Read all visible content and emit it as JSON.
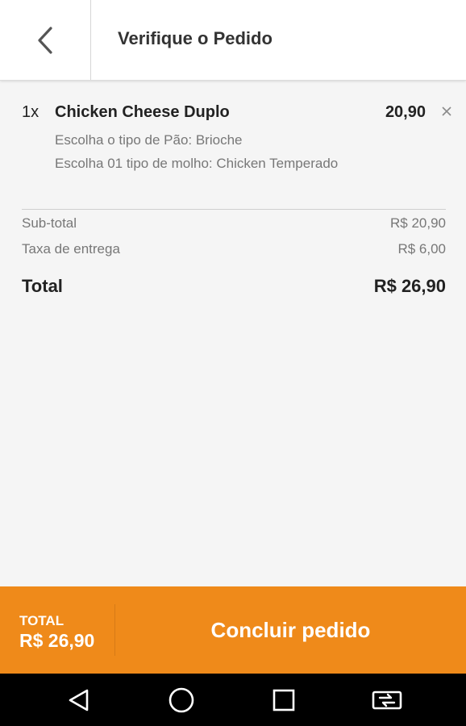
{
  "header": {
    "title": "Verifique o Pedido",
    "back_icon": "chevron-left-icon"
  },
  "order": {
    "items": [
      {
        "qty": "1x",
        "name": "Chicken Cheese Duplo",
        "price": "20,90",
        "remove_icon": "close-icon",
        "options": [
          "Escolha o tipo de Pão: Brioche",
          "Escolha 01 tipo de molho: Chicken Temperado"
        ]
      }
    ]
  },
  "summary": {
    "subtotal_label": "Sub-total",
    "subtotal_value": "R$ 20,90",
    "delivery_label": "Taxa de entrega",
    "delivery_value": "R$ 6,00",
    "total_label": "Total",
    "total_value": "R$ 26,90"
  },
  "bottom_bar": {
    "total_label": "TOTAL",
    "total_value": "R$ 26,90",
    "button_label": "Concluir pedido",
    "accent_color": "#ef8a1a"
  },
  "system_nav": {
    "icons": [
      "back-triangle-icon",
      "home-circle-icon",
      "recents-square-icon",
      "screen-cast-icon"
    ]
  }
}
